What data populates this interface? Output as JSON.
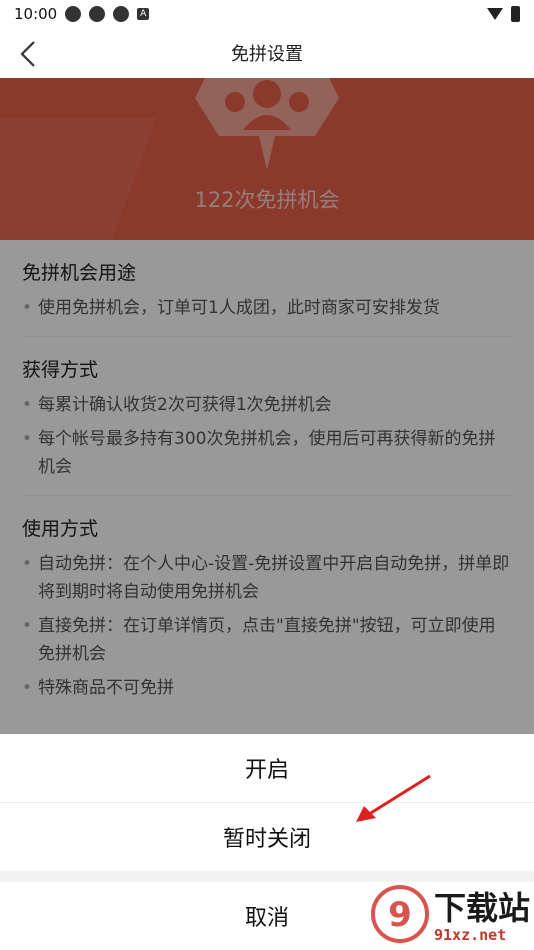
{
  "status_bar": {
    "time": "10:00",
    "left_icons": [
      "gear-icon",
      "gear-icon",
      "gear-icon",
      "a-icon"
    ],
    "a_label": "A",
    "right_icons": [
      "wifi-icon",
      "battery-icon"
    ]
  },
  "nav": {
    "title": "免拼设置",
    "back_icon": "chevron-left-icon"
  },
  "hero": {
    "count_text": "122次免拼机会",
    "badge_icon": "group-badge-icon",
    "color": "#e8604b"
  },
  "sections": [
    {
      "title": "免拼机会用途",
      "items": [
        "使用免拼机会，订单可1人成团，此时商家可安排发货"
      ]
    },
    {
      "title": "获得方式",
      "items": [
        "每累计确认收货2次可获得1次免拼机会",
        "每个帐号最多持有300次免拼机会，使用后可再获得新的免拼机会"
      ]
    },
    {
      "title": "使用方式",
      "items": [
        "自动免拼：在个人中心-设置-免拼设置中开启自动免拼，拼单即将到期时将自动使用免拼机会",
        "直接免拼：在订单详情页，点击\"直接免拼\"按钮，可立即使用免拼机会",
        "特殊商品不可免拼"
      ]
    }
  ],
  "sheet": {
    "open_label": "开启",
    "pause_label": "暂时关闭",
    "cancel_label": "取消"
  },
  "watermark": {
    "main": "下载站",
    "url": "91xz.net",
    "logo_digits": "9"
  },
  "annotation": {
    "arrow_color": "#e02020"
  }
}
